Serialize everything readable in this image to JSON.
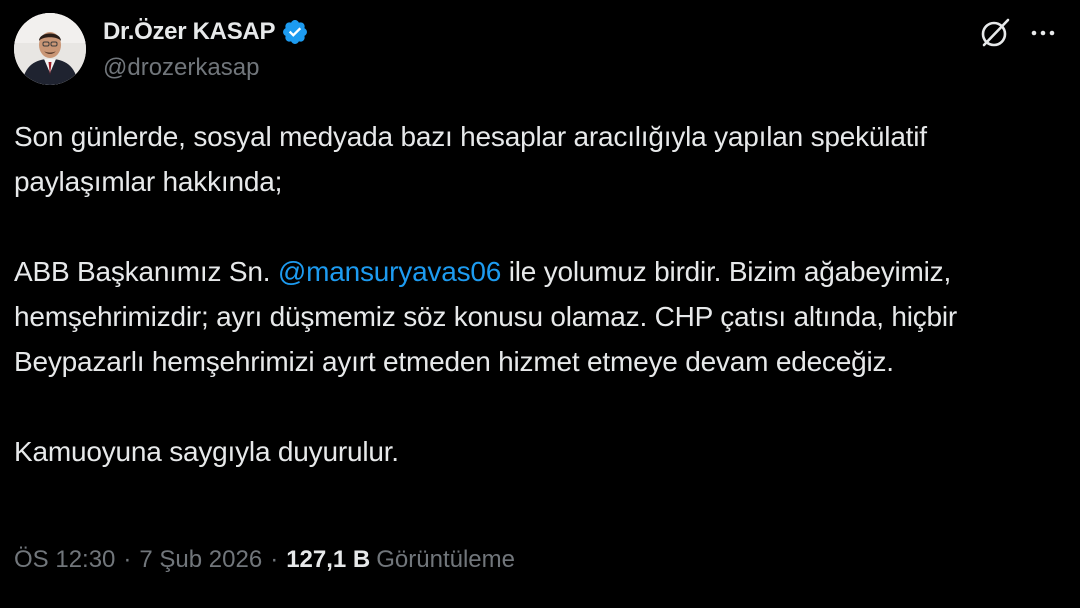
{
  "author": {
    "display_name": "Dr.Özer KASAP",
    "handle": "@drozerkasap",
    "verified": true,
    "verified_color": "#1d9bf0"
  },
  "icons": {
    "grok": "grok-icon",
    "more": "more-horizontal-icon",
    "verified": "verified-badge-icon"
  },
  "tweet": {
    "para1": "Son günlerde, sosyal medyada bazı hesaplar aracılığıyla yapılan spekülatif paylaşımlar hakkında;",
    "para2_before": "ABB Başkanımız Sn. ",
    "mention": "@mansuryavas06",
    "para2_after": " ile yolumuz birdir. Bizim ağabeyimiz, hemşehrimizdir; ayrı düşmemiz söz konusu olamaz. CHP çatısı altında, hiçbir Beypazarlı hemşehrimizi ayırt etmeden hizmet etmeye devam edeceğiz.",
    "para3": "Kamuoyuna saygıyla duyurulur."
  },
  "meta": {
    "time": "ÖS 12:30",
    "separator": "·",
    "date": "7 Şub 2026",
    "views_count": "127,1 B",
    "views_label": "Görüntüleme"
  },
  "colors": {
    "background": "#000000",
    "text": "#e7e9ea",
    "secondary": "#71767b",
    "accent": "#1d9bf0"
  }
}
